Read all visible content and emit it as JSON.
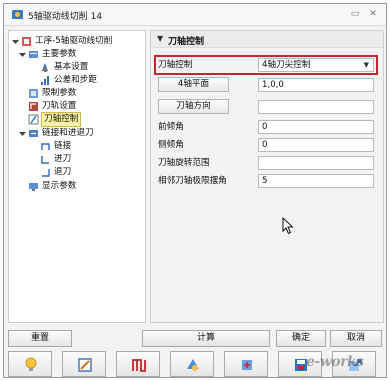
{
  "window": {
    "title": "5轴驱动线切削 14",
    "pin_glyph": "▭",
    "close_glyph": "✕"
  },
  "tree": {
    "items": [
      {
        "label": "工序-5轴驱动线切削",
        "level": 0,
        "expander": "minus",
        "icon": "operation-icon"
      },
      {
        "label": "主要参数",
        "level": 1,
        "expander": "minus",
        "icon": "main-params-icon"
      },
      {
        "label": "基本设置",
        "level": 2,
        "expander": "",
        "icon": "basic-settings-icon"
      },
      {
        "label": "公差和步距",
        "level": 2,
        "expander": "",
        "icon": "tolerance-icon"
      },
      {
        "label": "限制参数",
        "level": 1,
        "expander": "",
        "icon": "limit-params-icon"
      },
      {
        "label": "刀轨设置",
        "level": 1,
        "expander": "",
        "icon": "toolpath-settings-icon"
      },
      {
        "label": "刀轴控制",
        "level": 1,
        "expander": "",
        "icon": "tool-axis-icon",
        "selected": true
      },
      {
        "label": "链接和进退刀",
        "level": 1,
        "expander": "minus",
        "icon": "link-icon"
      },
      {
        "label": "链接",
        "level": 2,
        "expander": "",
        "icon": "link-sub-icon"
      },
      {
        "label": "进刀",
        "level": 2,
        "expander": "",
        "icon": "lead-in-icon"
      },
      {
        "label": "退刀",
        "level": 2,
        "expander": "",
        "icon": "lead-out-icon"
      },
      {
        "label": "显示参数",
        "level": 1,
        "expander": "",
        "icon": "display-params-icon"
      }
    ]
  },
  "panel": {
    "header": "刀轴控制",
    "tool_axis_label": "刀轴控制",
    "tool_axis_value": "4轴刀尖控制",
    "axis4_plane_button": "4轴平面",
    "axis4_plane_value": "1,0,0",
    "tool_direction_button": "刀轴方向",
    "tool_direction_value": "",
    "lead_angle_label": "前倾角",
    "lead_angle_value": "0",
    "tilt_angle_label": "侧倾角",
    "tilt_angle_value": "0",
    "rotation_range_label": "刀轴旋转范围",
    "rotation_range_value": "",
    "adjacent_limit_label": "相邻刀轴极限摆角",
    "adjacent_limit_value": "5"
  },
  "footer": {
    "reset": "重置",
    "calculate": "计算",
    "ok": "确定",
    "cancel": "取消"
  },
  "toolbar": {
    "icons": [
      "lightbulb-icon",
      "edit-icon",
      "toolpath-icon",
      "simulate-icon",
      "parameter-icon",
      "save-icon",
      "export-icon"
    ]
  },
  "watermark": "e-works",
  "colors": {
    "highlight": "#c4262e",
    "selected_bg": "#fff2a8",
    "window_bg": "#f3f3f3"
  }
}
